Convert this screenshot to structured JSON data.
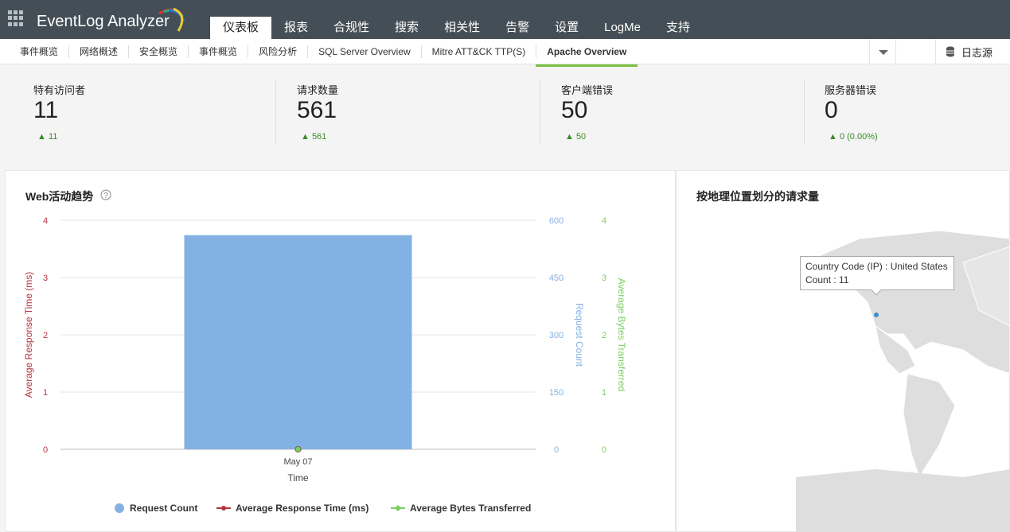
{
  "app": {
    "title": "EventLog Analyzer"
  },
  "nav": {
    "tabs": [
      "仪表板",
      "报表",
      "合规性",
      "搜索",
      "相关性",
      "告警",
      "设置",
      "LogMe",
      "支持"
    ]
  },
  "subnav": {
    "items": [
      "事件概览",
      "网络概述",
      "安全概览",
      "事件概览",
      "风险分析",
      "SQL Server Overview",
      "Mitre ATT&CK TTP(S)",
      "Apache Overview"
    ],
    "active": "Apache Overview",
    "log_source": "日志源"
  },
  "stats": [
    {
      "label": "特有访问者",
      "value": "11",
      "change": "▲ 11"
    },
    {
      "label": "请求数量",
      "value": "561",
      "change": "▲ 561"
    },
    {
      "label": "客户端错误",
      "value": "50",
      "change": "▲ 50"
    },
    {
      "label": "服务器错误",
      "value": "0",
      "change": "▲ 0 (0.00%)"
    }
  ],
  "web_panel": {
    "title": "Web活动趋势"
  },
  "geo_panel": {
    "title": "按地理位置划分的请求量",
    "tooltip_line1": "Country Code (IP) : United States",
    "tooltip_line2": "Count : 11"
  },
  "chart_data": {
    "type": "bar",
    "categories": [
      "May 07"
    ],
    "xlabel": "Time",
    "series": [
      {
        "name": "Request Count",
        "values": [
          561
        ],
        "axis": "Request Count",
        "ylim": [
          0,
          600
        ],
        "ticks": [
          "0",
          "150",
          "300",
          "450",
          "600"
        ],
        "color": "#84b1e4"
      },
      {
        "name": "Average Response Time (ms)",
        "values": [
          0
        ],
        "axis": "Average Response Time (ms)",
        "ylim": [
          0,
          4
        ],
        "ticks": [
          "0",
          "1",
          "2",
          "3",
          "4"
        ],
        "color": "#b5343c"
      },
      {
        "name": "Average Bytes Transferred",
        "values": [
          0
        ],
        "axis": "Average Bytes Transferred",
        "ylim": [
          0,
          4
        ],
        "ticks": [
          "0",
          "1",
          "2",
          "3",
          "4"
        ],
        "color": "#7ccf5e"
      }
    ],
    "grid": true,
    "legend": "bottom"
  }
}
